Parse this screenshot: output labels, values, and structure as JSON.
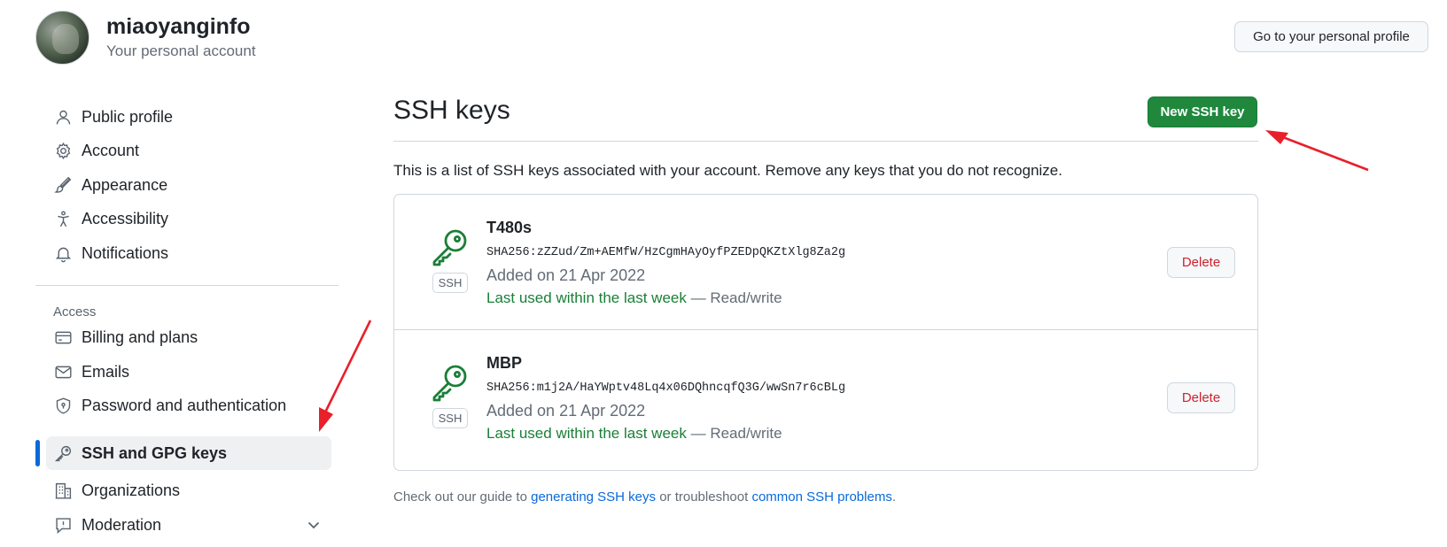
{
  "header": {
    "username": "miaoyanginfo",
    "subtitle": "Your personal account",
    "profile_button": "Go to your personal profile"
  },
  "sidebar": {
    "items": [
      {
        "label": "Public profile",
        "icon": "person-icon"
      },
      {
        "label": "Account",
        "icon": "gear-icon"
      },
      {
        "label": "Appearance",
        "icon": "paintbrush-icon"
      },
      {
        "label": "Accessibility",
        "icon": "accessibility-icon"
      },
      {
        "label": "Notifications",
        "icon": "bell-icon"
      }
    ],
    "access_heading": "Access",
    "access_items": [
      {
        "label": "Billing and plans",
        "icon": "credit-card-icon"
      },
      {
        "label": "Emails",
        "icon": "mail-icon"
      },
      {
        "label": "Password and authentication",
        "icon": "shield-lock-icon"
      },
      {
        "label": "SSH and GPG keys",
        "icon": "key-icon",
        "active": true
      },
      {
        "label": "Organizations",
        "icon": "organization-icon"
      },
      {
        "label": "Moderation",
        "icon": "report-icon"
      }
    ]
  },
  "main": {
    "title": "SSH keys",
    "new_button": "New SSH key",
    "intro": "This is a list of SSH keys associated with your account. Remove any keys that you do not recognize.",
    "keys": [
      {
        "title": "T480s",
        "fingerprint": "SHA256:zZZud/Zm+AEMfW/HzCgmHAyOyfPZEDpQKZtXlg8Za2g",
        "added": "Added on 21 Apr 2022",
        "last_used": "Last used within the last week",
        "access": "— Read/write",
        "badge": "SSH",
        "delete_label": "Delete"
      },
      {
        "title": "MBP",
        "fingerprint": "SHA256:m1j2A/HaYWptv48Lq4x06DQhncqfQ3G/wwSn7r6cBLg",
        "added": "Added on 21 Apr 2022",
        "last_used": "Last used within the last week",
        "access": "— Read/write",
        "badge": "SSH",
        "delete_label": "Delete"
      }
    ],
    "footer": {
      "prefix": "Check out our guide to ",
      "link1": "generating SSH keys",
      "middle": " or troubleshoot ",
      "link2": "common SSH problems",
      "suffix": "."
    }
  },
  "colors": {
    "primary_green": "#1f883d",
    "link_blue": "#0969da",
    "danger_red": "#cf222e",
    "annotation_red": "#e8202a"
  }
}
